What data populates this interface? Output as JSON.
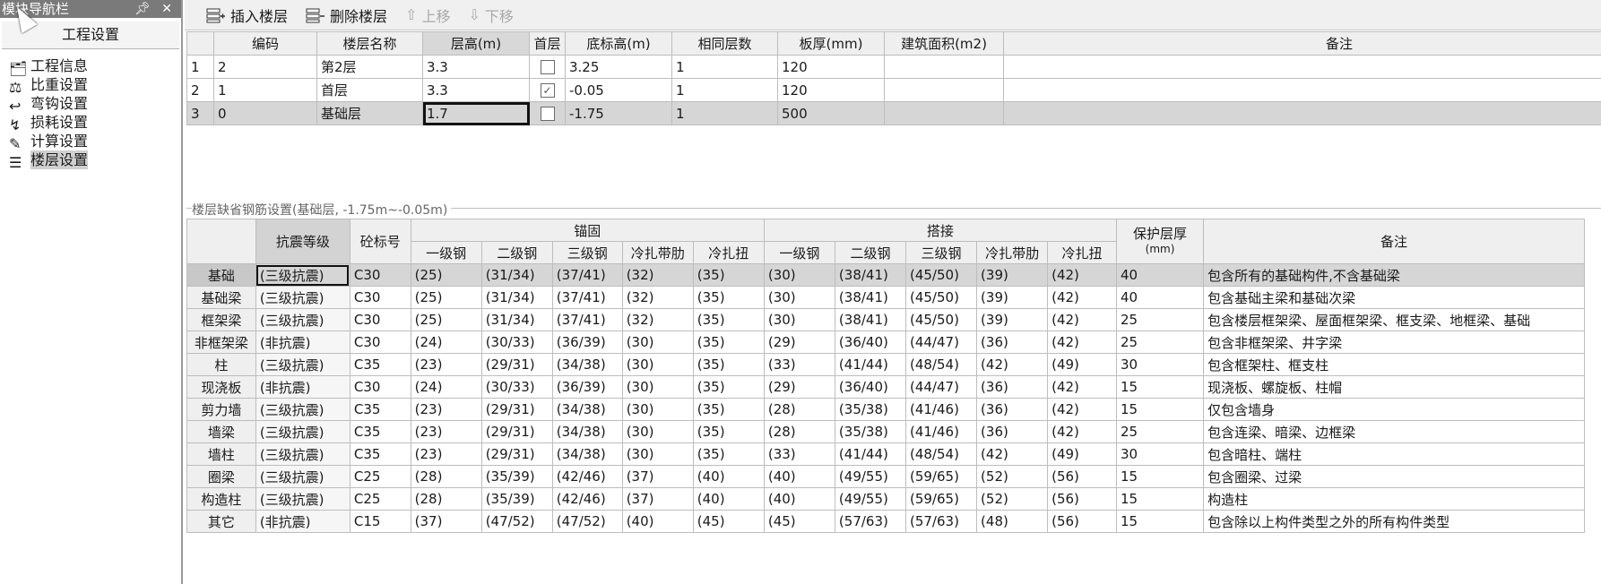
{
  "nav": {
    "title": "模块导航栏",
    "pin": "ᵖ",
    "close": "✕",
    "section": "工程设置",
    "items": [
      {
        "label": "工程信息",
        "icon": "info-card-icon"
      },
      {
        "label": "比重设置",
        "icon": "weight-icon"
      },
      {
        "label": "弯钩设置",
        "icon": "hook-icon"
      },
      {
        "label": "损耗设置",
        "icon": "loss-icon"
      },
      {
        "label": "计算设置",
        "icon": "calc-icon"
      },
      {
        "label": "楼层设置",
        "icon": "floors-icon",
        "selected": true
      }
    ]
  },
  "toolbar": {
    "insert": "插入楼层",
    "delete": "删除楼层",
    "up": "上移",
    "down": "下移"
  },
  "floors": {
    "headers": [
      "",
      "编码",
      "楼层名称",
      "层高(m)",
      "首层",
      "底标高(m)",
      "相同层数",
      "板厚(mm)",
      "建筑面积(m2)",
      "备注"
    ],
    "rows": [
      {
        "idx": "1",
        "code": "2",
        "name": "第2层",
        "height": "3.3",
        "first": false,
        "base": "3.25",
        "same": "1",
        "slab": "120",
        "area": "",
        "note": ""
      },
      {
        "idx": "2",
        "code": "1",
        "name": "首层",
        "height": "3.3",
        "first": true,
        "base": "-0.05",
        "same": "1",
        "slab": "120",
        "area": "",
        "note": ""
      },
      {
        "idx": "3",
        "code": "0",
        "name": "基础层",
        "height": "1.7",
        "first": false,
        "base": "-1.75",
        "same": "1",
        "slab": "500",
        "area": "",
        "note": ""
      }
    ]
  },
  "rebar_section_label": "楼层缺省钢筋设置(基础层, -1.75m~-0.05m)",
  "rebar": {
    "h_seismic": "抗震等级",
    "h_concrete": "砼标号",
    "h_anchor": "锚固",
    "h_lap": "搭接",
    "h_cover": "保护层厚\n(mm)",
    "h_cover1": "保护层厚",
    "h_cover2": "(mm)",
    "h_note": "备注",
    "sub": [
      "一级钢",
      "二级钢",
      "三级钢",
      "冷扎带肋",
      "冷扎扭"
    ],
    "rows": [
      {
        "name": "基础",
        "grade": "(三级抗震)",
        "conc": "C30",
        "a": [
          "(25)",
          "(31/34)",
          "(37/41)",
          "(32)",
          "(35)"
        ],
        "l": [
          "(30)",
          "(38/41)",
          "(45/50)",
          "(39)",
          "(42)"
        ],
        "cover": "40",
        "note": "包含所有的基础构件,不含基础梁"
      },
      {
        "name": "基础梁",
        "grade": "(三级抗震)",
        "conc": "C30",
        "a": [
          "(25)",
          "(31/34)",
          "(37/41)",
          "(32)",
          "(35)"
        ],
        "l": [
          "(30)",
          "(38/41)",
          "(45/50)",
          "(39)",
          "(42)"
        ],
        "cover": "40",
        "note": "包含基础主梁和基础次梁"
      },
      {
        "name": "框架梁",
        "grade": "(三级抗震)",
        "conc": "C30",
        "a": [
          "(25)",
          "(31/34)",
          "(37/41)",
          "(32)",
          "(35)"
        ],
        "l": [
          "(30)",
          "(38/41)",
          "(45/50)",
          "(39)",
          "(42)"
        ],
        "cover": "25",
        "note": "包含楼层框架梁、屋面框架梁、框支梁、地框梁、基础"
      },
      {
        "name": "非框架梁",
        "grade": "(非抗震)",
        "conc": "C30",
        "a": [
          "(24)",
          "(30/33)",
          "(36/39)",
          "(30)",
          "(35)"
        ],
        "l": [
          "(29)",
          "(36/40)",
          "(44/47)",
          "(36)",
          "(42)"
        ],
        "cover": "25",
        "note": "包含非框架梁、井字梁"
      },
      {
        "name": "柱",
        "grade": "(三级抗震)",
        "conc": "C35",
        "a": [
          "(23)",
          "(29/31)",
          "(34/38)",
          "(30)",
          "(35)"
        ],
        "l": [
          "(33)",
          "(41/44)",
          "(48/54)",
          "(42)",
          "(49)"
        ],
        "cover": "30",
        "note": "包含框架柱、框支柱"
      },
      {
        "name": "现浇板",
        "grade": "(非抗震)",
        "conc": "C30",
        "a": [
          "(24)",
          "(30/33)",
          "(36/39)",
          "(30)",
          "(35)"
        ],
        "l": [
          "(29)",
          "(36/40)",
          "(44/47)",
          "(36)",
          "(42)"
        ],
        "cover": "15",
        "note": "现浇板、螺旋板、柱帽"
      },
      {
        "name": "剪力墙",
        "grade": "(三级抗震)",
        "conc": "C35",
        "a": [
          "(23)",
          "(29/31)",
          "(34/38)",
          "(30)",
          "(35)"
        ],
        "l": [
          "(28)",
          "(35/38)",
          "(41/46)",
          "(36)",
          "(42)"
        ],
        "cover": "15",
        "note": "仅包含墙身"
      },
      {
        "name": "墙梁",
        "grade": "(三级抗震)",
        "conc": "C35",
        "a": [
          "(23)",
          "(29/31)",
          "(34/38)",
          "(30)",
          "(35)"
        ],
        "l": [
          "(28)",
          "(35/38)",
          "(41/46)",
          "(36)",
          "(42)"
        ],
        "cover": "25",
        "note": "包含连梁、暗梁、边框梁"
      },
      {
        "name": "墙柱",
        "grade": "(三级抗震)",
        "conc": "C35",
        "a": [
          "(23)",
          "(29/31)",
          "(34/38)",
          "(30)",
          "(35)"
        ],
        "l": [
          "(33)",
          "(41/44)",
          "(48/54)",
          "(42)",
          "(49)"
        ],
        "cover": "30",
        "note": "包含暗柱、端柱"
      },
      {
        "name": "圈梁",
        "grade": "(三级抗震)",
        "conc": "C25",
        "a": [
          "(28)",
          "(35/39)",
          "(42/46)",
          "(37)",
          "(40)"
        ],
        "l": [
          "(40)",
          "(49/55)",
          "(59/65)",
          "(52)",
          "(56)"
        ],
        "cover": "15",
        "note": "包含圈梁、过梁"
      },
      {
        "name": "构造柱",
        "grade": "(三级抗震)",
        "conc": "C25",
        "a": [
          "(28)",
          "(35/39)",
          "(42/46)",
          "(37)",
          "(40)"
        ],
        "l": [
          "(40)",
          "(49/55)",
          "(59/65)",
          "(52)",
          "(56)"
        ],
        "cover": "15",
        "note": "构造柱"
      },
      {
        "name": "其它",
        "grade": "(非抗震)",
        "conc": "C15",
        "a": [
          "(37)",
          "(47/52)",
          "(47/52)",
          "(40)",
          "(45)"
        ],
        "l": [
          "(45)",
          "(57/63)",
          "(57/63)",
          "(48)",
          "(56)"
        ],
        "cover": "15",
        "note": "包含除以上构件类型之外的所有构件类型"
      }
    ]
  }
}
